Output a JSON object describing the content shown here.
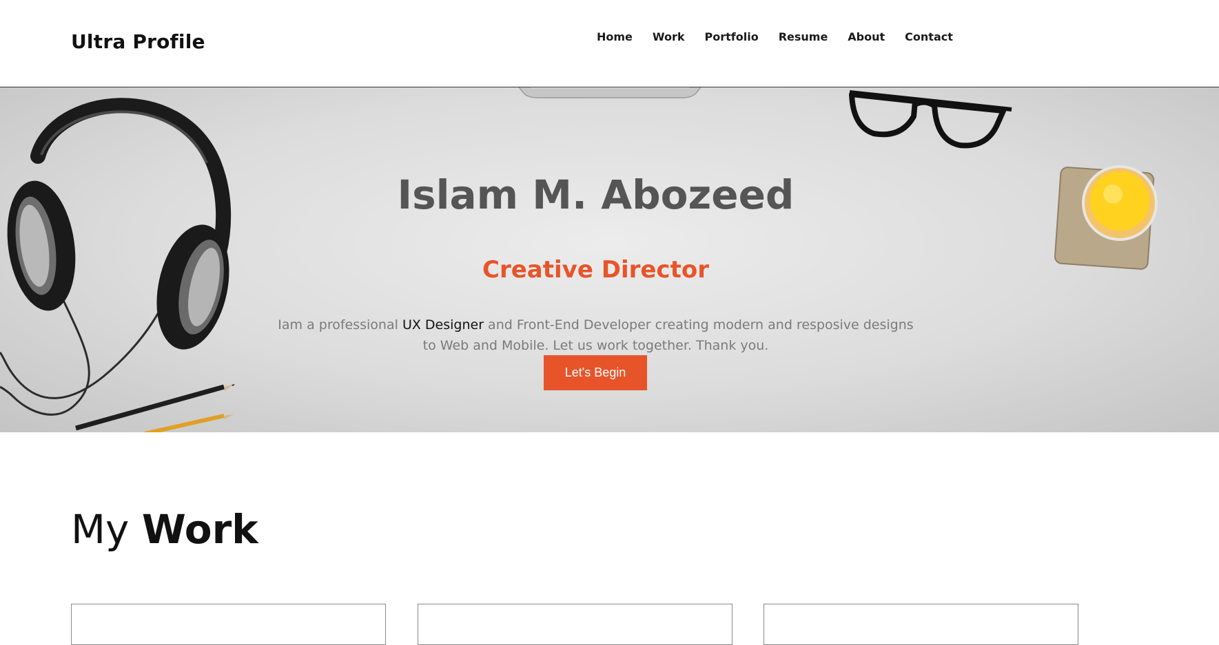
{
  "header": {
    "brand": "Ultra Profile",
    "nav": [
      "Home",
      "Work",
      "Portfolio",
      "Resume",
      "About",
      "Contact"
    ]
  },
  "hero": {
    "name": "Islam M. Abozeed",
    "role": "Creative Director",
    "desc_before": "Iam a professional ",
    "desc_highlight": "UX Designer",
    "desc_after": " and Front-End Developer creating modern and resposive designs to Web and Mobile. Let us work together. Thank you.",
    "cta": "Let's Begin"
  },
  "work": {
    "title_light": "My ",
    "title_bold": "Work"
  },
  "colors": {
    "accent": "#e8542a",
    "title_gray": "#555555",
    "text_gray": "#7a7a7a"
  },
  "icons": [
    "headphones-icon",
    "glasses-icon",
    "juice-glass-icon",
    "pencil-icon",
    "monitor-stand-icon"
  ]
}
